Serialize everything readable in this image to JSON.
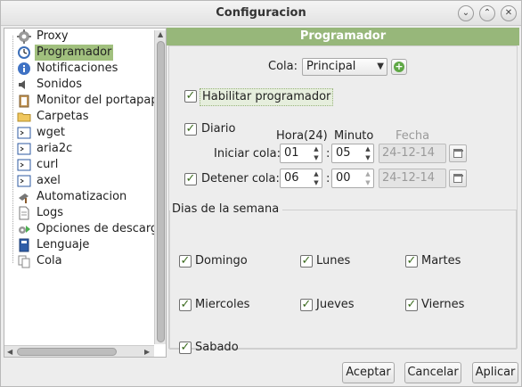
{
  "window": {
    "title": "Configuracion"
  },
  "tree": {
    "items": [
      {
        "label": "Proxy",
        "icon": "gear-icon"
      },
      {
        "label": "Programador",
        "icon": "clock-icon",
        "selected": true
      },
      {
        "label": "Notificaciones",
        "icon": "info-icon"
      },
      {
        "label": "Sonidos",
        "icon": "speaker-icon"
      },
      {
        "label": "Monitor del portapap",
        "icon": "clipboard-icon"
      },
      {
        "label": "Carpetas",
        "icon": "folder-icon"
      },
      {
        "label": "wget",
        "icon": "terminal-icon"
      },
      {
        "label": "aria2c",
        "icon": "terminal-icon"
      },
      {
        "label": "curl",
        "icon": "terminal-icon"
      },
      {
        "label": "axel",
        "icon": "terminal-icon"
      },
      {
        "label": "Automatizacion",
        "icon": "hammer-icon"
      },
      {
        "label": "Logs",
        "icon": "document-icon"
      },
      {
        "label": "Opciones de descarg",
        "icon": "download-options-icon"
      },
      {
        "label": "Lenguaje",
        "icon": "book-icon"
      },
      {
        "label": "Cola",
        "icon": "copy-icon"
      }
    ]
  },
  "panel": {
    "header": "Programador",
    "cola_label": "Cola:",
    "cola_value": "Principal",
    "enable_label": "Habilitar programador",
    "diario_label": "Diario",
    "hora_header": "Hora(24)",
    "minuto_header": "Minuto",
    "fecha_header": "Fecha",
    "start_label": "Iniciar cola:",
    "start_hour": "01",
    "start_minute": "05",
    "start_date": "24-12-14",
    "stop_label": "Detener cola:",
    "stop_hour": "06",
    "stop_minute": "00",
    "stop_date": "24-12-14",
    "colon": ":",
    "days_title": "Dias de la semana",
    "days": [
      "Domingo",
      "Lunes",
      "Martes",
      "Miercoles",
      "Jueves",
      "Viernes",
      "Sabado"
    ]
  },
  "buttons": {
    "ok": "Aceptar",
    "cancel": "Cancelar",
    "apply": "Aplicar"
  },
  "colors": {
    "accent": "#97b77a",
    "selection": "#a1c07e"
  }
}
